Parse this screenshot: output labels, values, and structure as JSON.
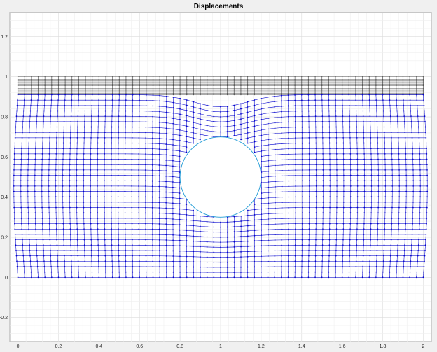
{
  "chart_data": {
    "type": "line",
    "title": "Displacements",
    "xlabel": "",
    "ylabel": "",
    "xlim": [
      -0.04,
      2.04
    ],
    "ylim": [
      -0.32,
      1.32
    ],
    "xticks": [
      "0",
      "0.2",
      "0.4",
      "0.6",
      "0.8",
      "1",
      "1.2",
      "1.4",
      "1.6",
      "1.8",
      "2"
    ],
    "yticks": [
      "-0.2",
      "0",
      "0.2",
      "0.4",
      "0.6",
      "0.8",
      "1",
      "1.2"
    ],
    "grid": "on (major and minor)",
    "series": [
      {
        "role": "undeformed-mesh",
        "color": "#555555",
        "x_range": [
          0,
          2
        ],
        "y_range": [
          0,
          1
        ],
        "nx": 60,
        "ny": 14
      },
      {
        "role": "deformed-mesh",
        "color": "#0000cc",
        "x_range": [
          0,
          2
        ],
        "y_range": [
          0,
          0.91
        ],
        "nx": 60,
        "ny": 34
      },
      {
        "role": "hole-outline",
        "color": "#1f9bd6",
        "center": [
          1,
          0.5
        ],
        "radius": 0.2
      }
    ]
  }
}
